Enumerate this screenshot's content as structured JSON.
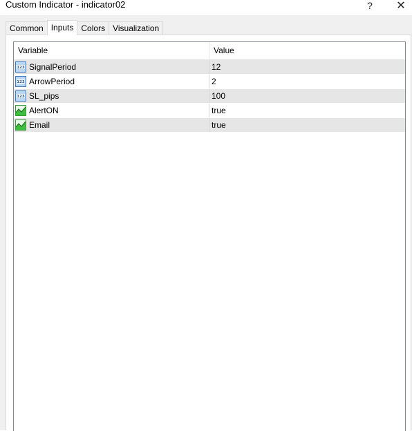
{
  "window": {
    "title": "Custom Indicator - indicator02",
    "help_glyph": "?",
    "close_glyph": "✕"
  },
  "tabs": [
    {
      "label": "Common",
      "active": false
    },
    {
      "label": "Inputs",
      "active": true
    },
    {
      "label": "Colors",
      "active": false
    },
    {
      "label": "Visualization",
      "active": false
    }
  ],
  "table": {
    "headers": {
      "variable": "Variable",
      "value": "Value"
    },
    "rows": [
      {
        "name": "SignalPeriod",
        "value": "12",
        "icon": "numeric-123-icon"
      },
      {
        "name": "ArrowPeriod",
        "value": "2",
        "icon": "numeric-123-icon"
      },
      {
        "name": "SL_pips",
        "value": "100",
        "icon": "numeric-123-icon"
      },
      {
        "name": "AlertON",
        "value": "true",
        "icon": "boolean-chart-icon"
      },
      {
        "name": "Email",
        "value": "true",
        "icon": "boolean-chart-icon"
      }
    ]
  },
  "colors": {
    "row_shade": "#e6e6e6",
    "num_icon_fill": "#bcd8f4",
    "num_icon_border": "#3a78c2",
    "bool_icon_fill": "#3fbf3f"
  }
}
